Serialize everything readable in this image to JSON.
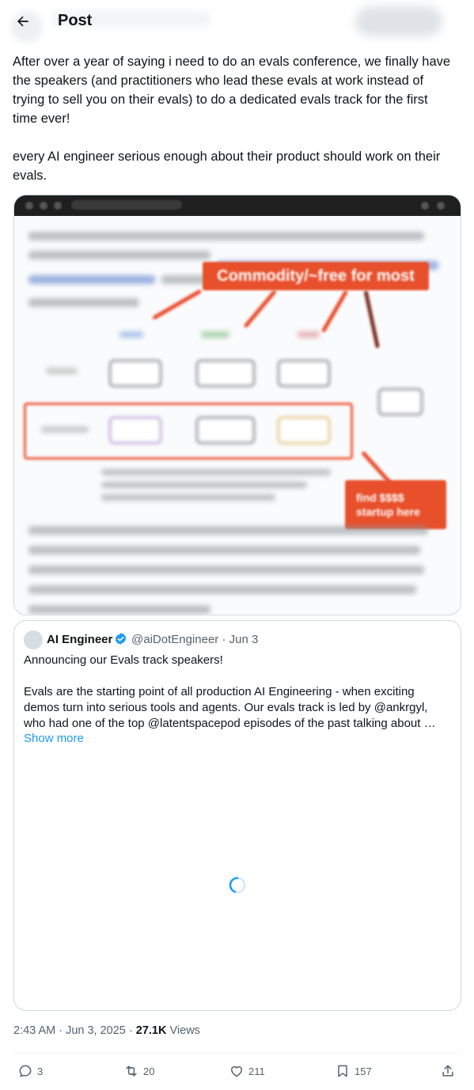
{
  "header": {
    "title": "Post"
  },
  "tweet": {
    "text": "After over a year of saying i need to do an evals conference, we finally have the speakers (and practitioners who lead these evals at work instead of trying to sell you on their evals) to do a dedicated evals track for the first time ever!\n\nevery AI engineer serious enough about their product should work on their evals."
  },
  "media": {
    "callout_main": "Commodity/~free for most",
    "callout_side": "find $$$$\nstartup here"
  },
  "quote": {
    "name": "AI Engineer",
    "handle_date": "@aiDotEngineer · Jun 3",
    "text": "Announcing our Evals track speakers!\n\nEvals are the starting point of all production AI Engineering - when exciting demos turn into serious tools and agents. Our evals track is led by @ankrgyl, who had one of the top @latentspacepod episodes of the past talking about …",
    "show_more": "Show more"
  },
  "meta": {
    "timestamp": "2:43 AM · Jun 3, 2025 · ",
    "views_count": "27.1K",
    "views_label": " Views"
  },
  "actions": {
    "replies": "3",
    "reposts": "20",
    "likes": "211",
    "bookmarks": "157"
  },
  "colors": {
    "accent": "#1d9bf0",
    "text": "#0f1419",
    "muted": "#536471",
    "callout": "#e8502c"
  }
}
